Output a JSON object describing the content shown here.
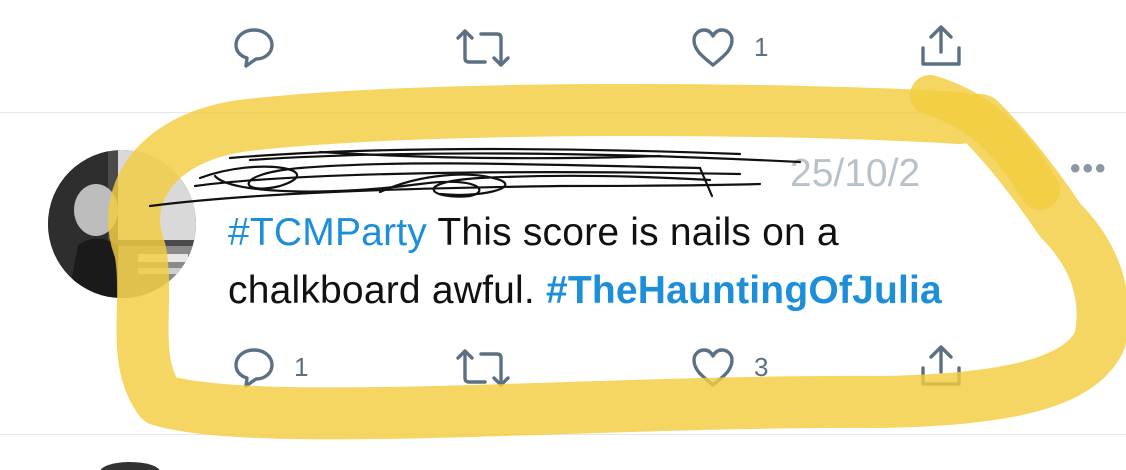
{
  "top_actions": {
    "reply_icon": "reply-icon",
    "retweet_icon": "retweet-icon",
    "like_icon": "heart-icon",
    "like_count": "1",
    "share_icon": "share-icon"
  },
  "tweet": {
    "date_partial": "25/10/2",
    "more_label": "•••",
    "hashtag_1": "#TCMParty",
    "text_line_1": " This score is nails on a",
    "text_line_2": "chalkboard awful. ",
    "hashtag_2": "#TheHauntingOfJulia",
    "reply_count": "1",
    "like_count": "3"
  },
  "annotation": {
    "highlight_color": "#f3cd3f",
    "scribble_color": "#111111"
  },
  "colors": {
    "icon": "#5b7083",
    "hashtag": "#1d8fd9",
    "text": "#111111",
    "divider": "#e3e7ea"
  }
}
